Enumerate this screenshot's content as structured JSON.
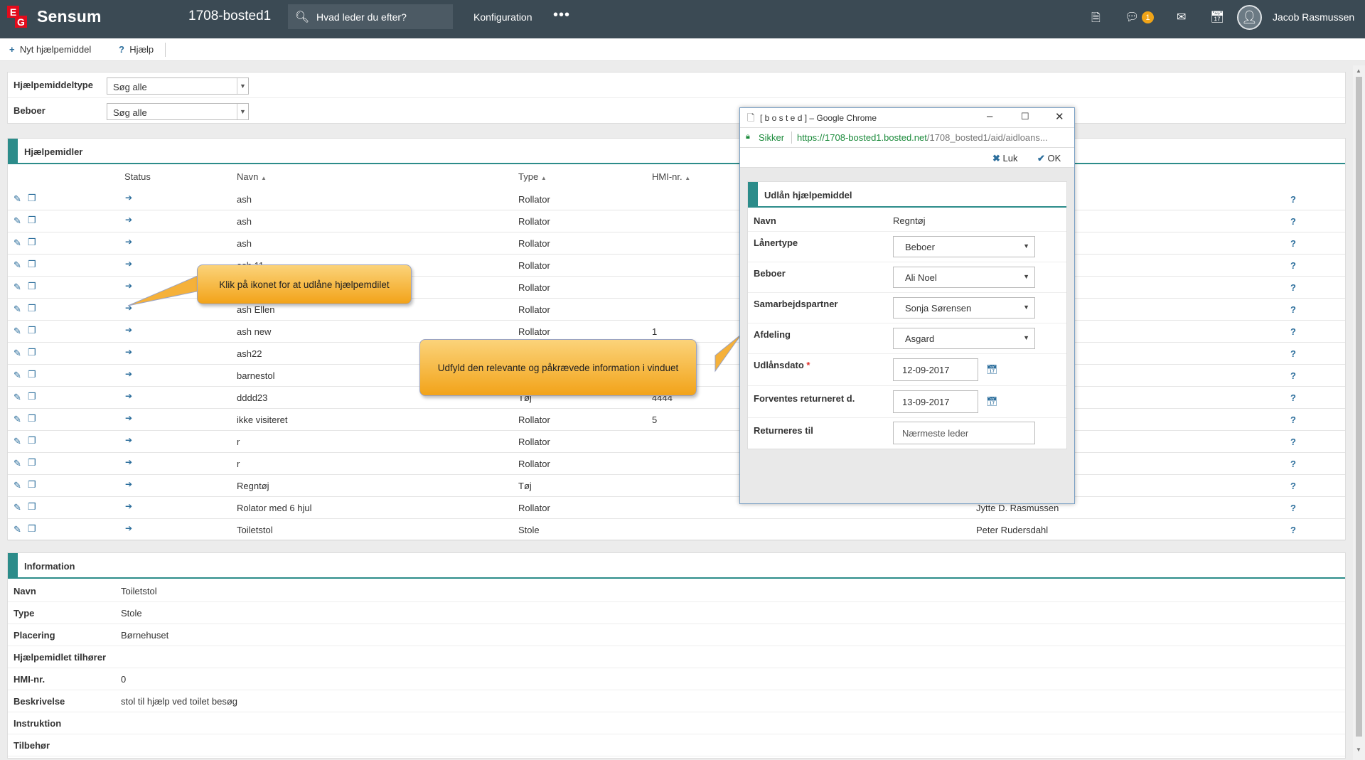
{
  "header": {
    "logo_e": "E",
    "logo_g": "G",
    "brand": "Sensum",
    "org": "1708-bosted1",
    "search_placeholder": "Hvad leder du efter?",
    "config": "Konfiguration",
    "more": "•••",
    "notification_count": "1",
    "user": "Jacob Rasmussen",
    "icons": [
      "document-icon",
      "chat-icon",
      "mail-icon",
      "calendar-icon",
      "user-avatar-icon"
    ]
  },
  "toolbar": {
    "new_label": "Nyt hjælpemiddel",
    "help_label": "Hjælp"
  },
  "filters": {
    "type_label": "Hjælpemiddeltype",
    "type_value": "Søg alle",
    "resident_label": "Beboer",
    "resident_value": "Søg alle"
  },
  "list": {
    "title": "Hjælpemidler",
    "columns": {
      "status": "Status",
      "name": "Navn",
      "type": "Type",
      "hmi": "HMI-nr."
    },
    "rows": [
      {
        "name": "ash",
        "type": "Rollator",
        "hmi": "",
        "owner": ""
      },
      {
        "name": "ash",
        "type": "Rollator",
        "hmi": "",
        "owner": ""
      },
      {
        "name": "ash",
        "type": "Rollator",
        "hmi": "",
        "owner": ""
      },
      {
        "name": "ash 11",
        "type": "Rollator",
        "hmi": "",
        "owner": ""
      },
      {
        "name": "",
        "type": "Rollator",
        "hmi": "",
        "owner": ""
      },
      {
        "name": "ash Ellen",
        "type": "Rollator",
        "hmi": "",
        "owner": ""
      },
      {
        "name": "ash new",
        "type": "Rollator",
        "hmi": "1",
        "owner": ""
      },
      {
        "name": "ash22",
        "type": "",
        "hmi": "",
        "owner": ""
      },
      {
        "name": "barnestol",
        "type": "",
        "hmi": "",
        "owner": ""
      },
      {
        "name": "dddd23",
        "type": "Tøj",
        "hmi": "4444",
        "owner": ""
      },
      {
        "name": "ikke visiteret",
        "type": "Rollator",
        "hmi": "5",
        "owner": ""
      },
      {
        "name": "r",
        "type": "Rollator",
        "hmi": "",
        "owner": ""
      },
      {
        "name": "r",
        "type": "Rollator",
        "hmi": "",
        "owner": ""
      },
      {
        "name": "Regntøj",
        "type": "Tøj",
        "hmi": "",
        "owner": ""
      },
      {
        "name": "Rolator med 6 hjul",
        "type": "Rollator",
        "hmi": "",
        "owner": "Jytte D. Rasmussen"
      },
      {
        "name": "Toiletstol",
        "type": "Stole",
        "hmi": "",
        "owner": "Peter Rudersdahl"
      }
    ],
    "help_mark": "?"
  },
  "info": {
    "title": "Information",
    "rows": [
      {
        "k": "Navn",
        "v": "Toiletstol"
      },
      {
        "k": "Type",
        "v": "Stole"
      },
      {
        "k": "Placering",
        "v": "Børnehuset"
      },
      {
        "k": "Hjælpemidlet tilhører",
        "v": ""
      },
      {
        "k": "HMI-nr.",
        "v": "0"
      },
      {
        "k": "Beskrivelse",
        "v": "stol til hjælp ved toilet besøg"
      },
      {
        "k": "Instruktion",
        "v": ""
      },
      {
        "k": "Tilbehør",
        "v": ""
      }
    ]
  },
  "callouts": {
    "icon_hint": "Klik på ikonet for at udlåne hjælpemdilet",
    "window_hint": "Udfyld den relevante og påkrævede information i vinduet"
  },
  "popup": {
    "window_title": "[ b o s t e d ] – Google Chrome",
    "secure": "Sikker",
    "url_host": "https://1708-bosted1.bosted.net",
    "url_path": "/1708_bosted1/aid/aidloans...",
    "close_label": "Luk",
    "ok_label": "OK",
    "form_title": "Udlån hjælpemiddel",
    "fields": {
      "name_label": "Navn",
      "name_value": "Regntøj",
      "loantype_label": "Lånertype",
      "loantype_value": "Beboer",
      "resident_label": "Beboer",
      "resident_value": "Ali Noel",
      "partner_label": "Samarbejdspartner",
      "partner_value": "Sonja Sørensen",
      "dept_label": "Afdeling",
      "dept_value": "Asgard",
      "loandate_label": "Udlånsdato",
      "required_mark": "*",
      "loandate_value": "12-09-2017",
      "return_label": "Forventes returneret d.",
      "return_value": "13-09-2017",
      "returnto_label": "Returneres til",
      "returnto_placeholder": "Nærmeste leder"
    }
  }
}
